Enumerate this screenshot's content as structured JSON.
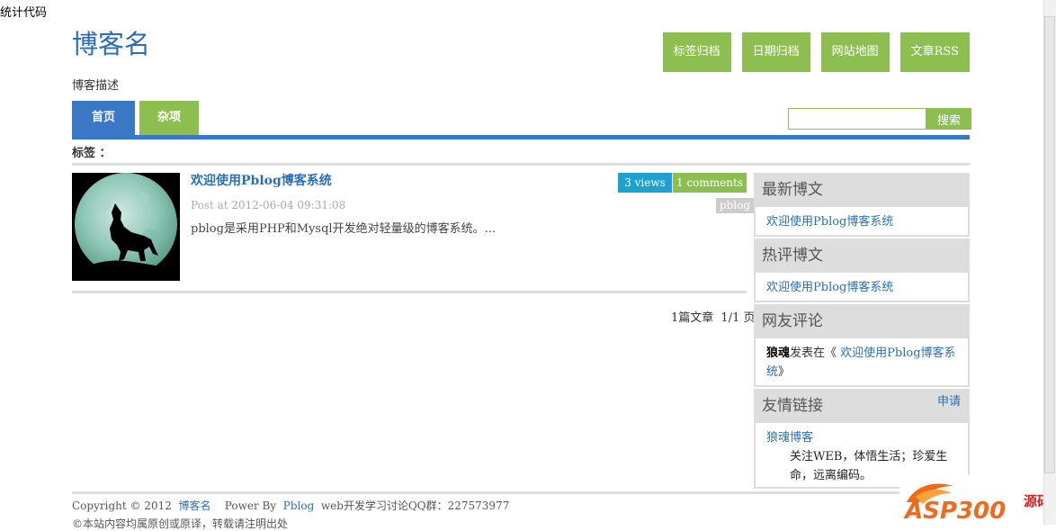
{
  "stats_code": "统计代码",
  "blog": {
    "title": "博客名",
    "description": "博客描述"
  },
  "top_links": [
    "标签归档",
    "日期归档",
    "网站地图",
    "文章RSS"
  ],
  "nav": {
    "tabs": [
      "首页",
      "杂项"
    ],
    "active": 0
  },
  "search": {
    "button": "搜索",
    "value": ""
  },
  "tags_label": "标签 ：",
  "post": {
    "title": "欢迎使用Pblog博客系统",
    "meta": "Post at 2012-06-04 09:31:08",
    "excerpt": "pblog是采用PHP和Mysql开发绝对轻量级的博客系统。...",
    "views": "3 views",
    "comments": "1 comments",
    "tag": "pblog"
  },
  "pagination": {
    "count": "1篇文章",
    "page": "1/1 页"
  },
  "sidebar": {
    "latest": {
      "title": "最新博文",
      "items": [
        "欢迎使用Pblog博客系统"
      ]
    },
    "hot": {
      "title": "热评博文",
      "items": [
        "欢迎使用Pblog博客系统"
      ]
    },
    "comments": {
      "title": "网友评论",
      "user": "狼魂",
      "text": "发表在《",
      "link": "欢迎使用Pblog博客系统",
      "close": "》"
    },
    "links": {
      "title": "友情链接",
      "apply": "申请",
      "site": "狼魂博客",
      "site_desc": "关注WEB，体悟生活；珍爱生命，远离编码。"
    }
  },
  "footer": {
    "copyright": "Copyright © 2012",
    "blog_name": "博客名",
    "power_by": "Power By",
    "pblog": "Pblog",
    "qq": "web开发学习讨论QQ群：227573977",
    "line2": "©本站内容均属原创或原译，转载请注明出处"
  },
  "watermark": {
    "brand": "ASP300",
    "suffix": "源码",
    "colors": {
      "orange": "#f06a1d",
      "red": "#d8201f"
    }
  },
  "colors": {
    "green": "#8cbf4f",
    "blue": "#3a77c4",
    "link": "#2a6fb5",
    "cyan": "#1ba2d0",
    "gray": "#dddddd"
  }
}
